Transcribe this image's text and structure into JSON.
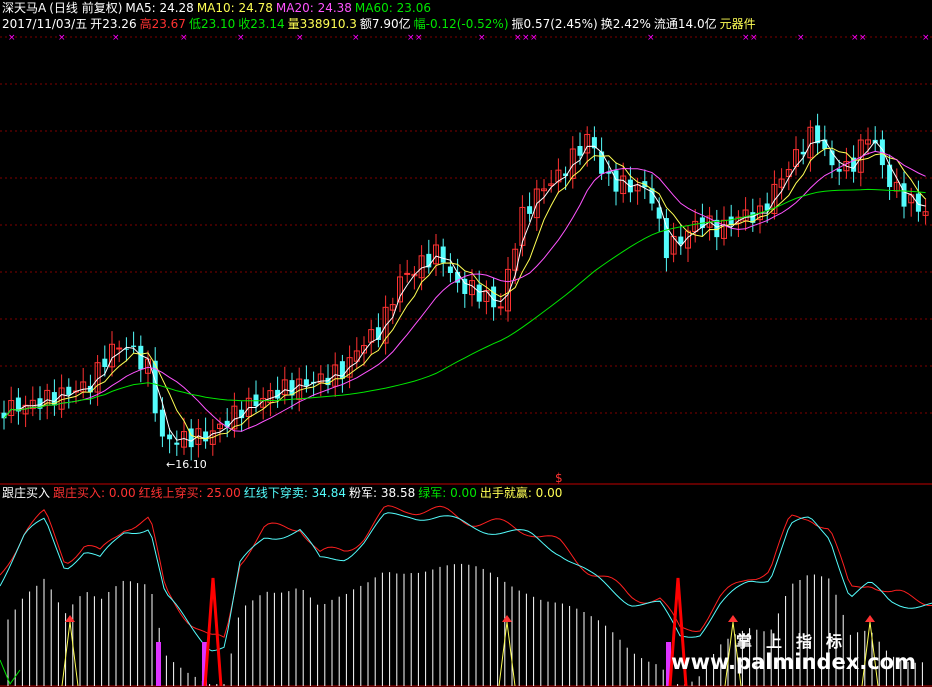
{
  "header": {
    "stock_name": "深天马A",
    "period": "(日线 前复权)",
    "ma5": "MA5: 24.28",
    "ma10": "MA10: 24.78",
    "ma20": "MA20: 24.38",
    "ma60": "MA60: 23.06",
    "date": "2017/11/03/五",
    "open": "开23.26",
    "high": "高23.67",
    "low": "低23.10",
    "close": "收23.14",
    "volume": "量338910.3",
    "amount": "额7.90亿",
    "change": "幅-0.12(-0.52%)",
    "amplitude": "振0.57(2.45%)",
    "turnover": "换2.42%",
    "float": "流通14.0亿",
    "sector": "元器件"
  },
  "price_panel": {
    "low_annotation": "←16.10",
    "marker": "$"
  },
  "indicator": {
    "name": "跟庄买入",
    "v1": "跟庄买入: 0.00",
    "v2": "红线上穿买: 25.00",
    "v3": "红线下穿卖: 34.84",
    "v4": "粉军: 38.58",
    "v5": "绿军: 0.00",
    "v6": "出手就赢: 0.00"
  },
  "watermark": {
    "cn": "掌上指标",
    "url": "www.palmindex.com"
  },
  "colors": {
    "up": "#ff3232",
    "down": "#54fcfc",
    "ma5": "#ffffff",
    "ma10": "#ffff54",
    "ma20": "#ff54ff",
    "ma60": "#00e600",
    "grid": "#800000",
    "cross": "#ff00ff"
  },
  "chart_data": {
    "type": "candlestick",
    "low_price": 16.1,
    "ma": {
      "MA5": 24.28,
      "MA10": 24.78,
      "MA20": 24.38,
      "MA60": 23.06
    },
    "last_bar": {
      "date": "2017/11/03",
      "open": 23.26,
      "high": 23.67,
      "low": 23.1,
      "close": 23.14
    },
    "indicator_values": {
      "跟庄买入": 0.0,
      "红线上穿买": 25.0,
      "红线下穿卖": 34.84,
      "粉军": 38.58,
      "绿军": 0.0,
      "出手就赢": 0.0
    }
  }
}
